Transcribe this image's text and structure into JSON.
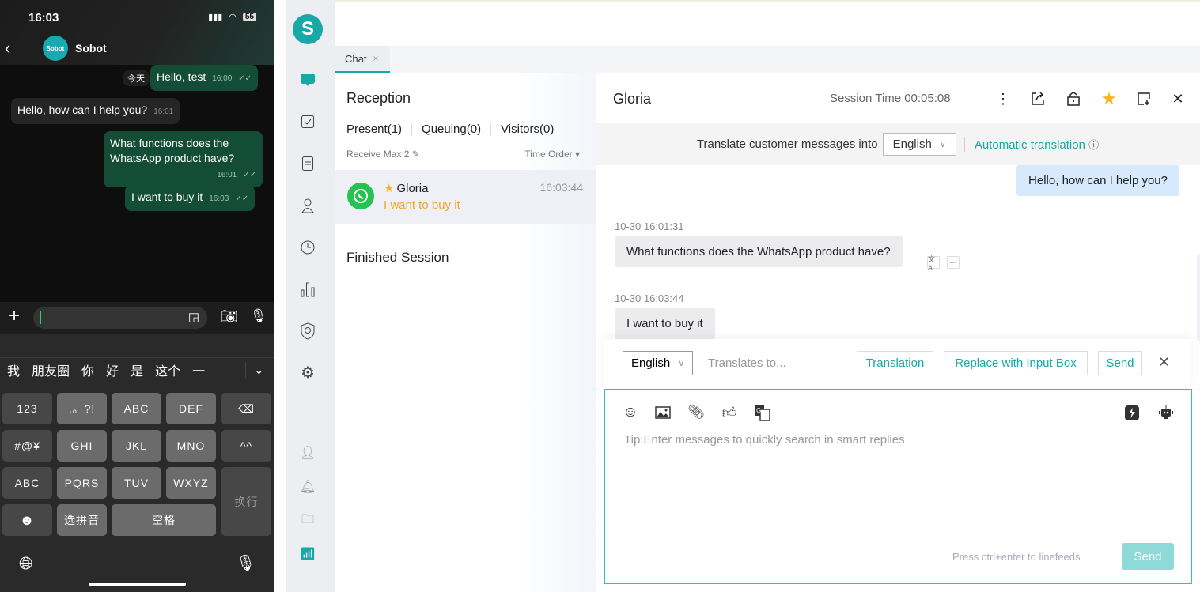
{
  "phone": {
    "status_time": "16:03",
    "battery": "55",
    "contact_name": "Sobot",
    "avatar_text": "Sobot",
    "today_label": "今天",
    "messages": [
      {
        "dir": "out",
        "text": "Hello, test",
        "time": "16:00"
      },
      {
        "dir": "in",
        "text": "Hello, how can I help you?",
        "time": "16:01"
      },
      {
        "dir": "out",
        "text": "What functions does the WhatsApp product have?",
        "time": "16:01"
      },
      {
        "dir": "out",
        "text": "I want to buy it",
        "time": "16:03"
      }
    ],
    "candidates": [
      "我",
      "朋友圈",
      "你",
      "好",
      "是",
      "这个",
      "一"
    ],
    "keys": {
      "k123": "123",
      "punct": ",。?!",
      "abc": "ABC",
      "def": "DEF",
      "sym": "#@¥",
      "ghi": "GHI",
      "jkl": "JKL",
      "mno": "MNO",
      "face": "^^",
      "abc2": "ABC",
      "pqrs": "PQRS",
      "tuv": "TUV",
      "wxyz": "WXYZ",
      "enter": "换行",
      "pinyin": "选拼音",
      "space": "空格"
    }
  },
  "rail": {
    "logo": "S"
  },
  "tabs": [
    {
      "label": "Chat",
      "close": "×"
    }
  ],
  "list": {
    "title": "Reception",
    "subtabs": [
      "Present(1)",
      "Queuing(0)",
      "Visitors(0)"
    ],
    "receive_max": "Receive Max 2",
    "order": "Time Order",
    "session": {
      "name": "Gloria",
      "last_message": "I want to buy it",
      "time": "16:03:44"
    },
    "finished": "Finished Session"
  },
  "chat": {
    "customer": "Gloria",
    "session_time": "Session Time 00:05:08",
    "translate_label": "Translate customer messages into",
    "translate_lang": "English",
    "auto_translation": "Automatic translation",
    "messages": [
      {
        "from": "agent",
        "text": "Hello, how can I help you?"
      },
      {
        "from": "customer",
        "time": "10-30 16:01:31",
        "text": "What functions does the WhatsApp product have?"
      },
      {
        "from": "customer",
        "time": "10-30 16:03:44",
        "text": "I want to buy it"
      }
    ],
    "translate_panel": {
      "lang": "English",
      "placeholder": "Translates to...",
      "translation_btn": "Translation",
      "replace_btn": "Replace with Input Box",
      "send_btn": "Send"
    },
    "editor": {
      "placeholder": "Tip:Enter messages to quickly search in smart replies",
      "hint": "Press ctrl+enter to linefeeds",
      "send": "Send"
    }
  },
  "colors": {
    "accent": "#16a9a6",
    "whatsapp": "#25c351",
    "star": "#fab41e"
  }
}
